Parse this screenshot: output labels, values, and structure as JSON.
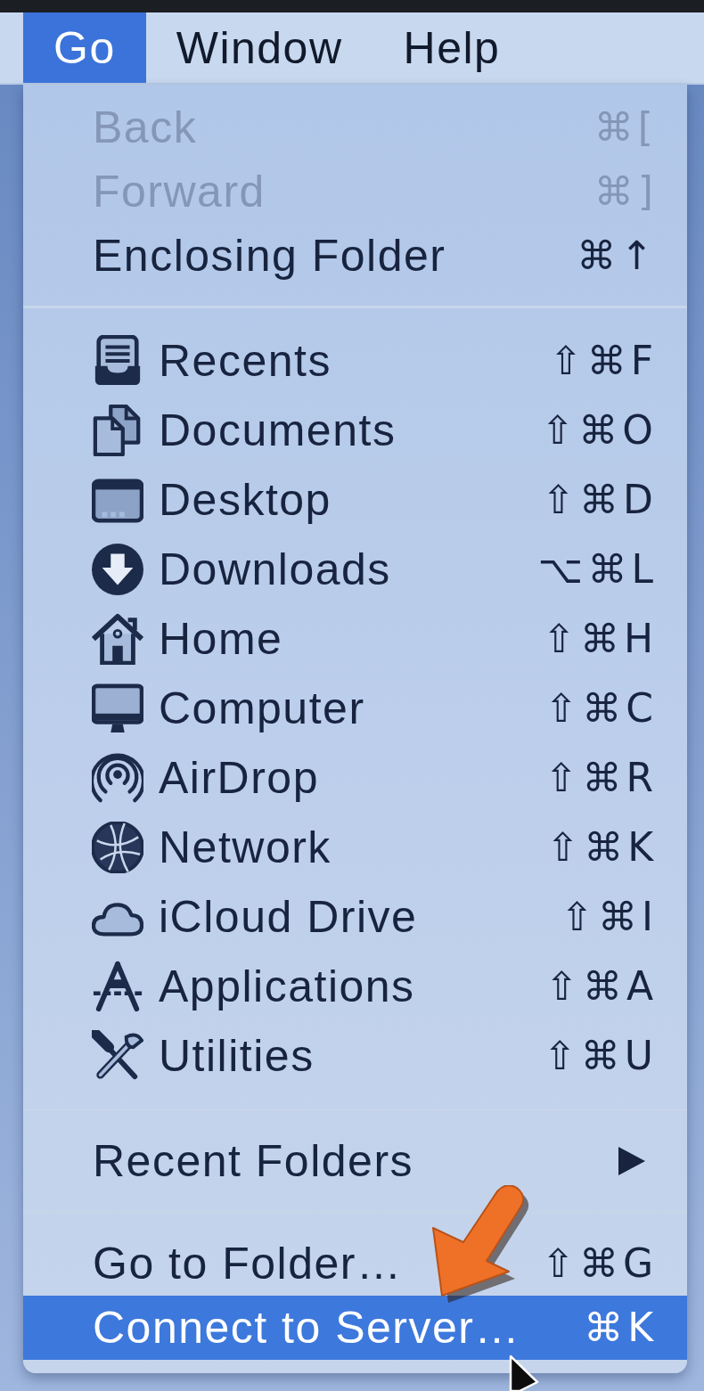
{
  "menu_bar": [
    {
      "label": "Go",
      "selected": true
    },
    {
      "label": "Window",
      "selected": false
    },
    {
      "label": "Help",
      "selected": false
    }
  ],
  "menu": {
    "sections": [
      {
        "items": [
          {
            "kind": "text",
            "label": "Back",
            "shortcut": "⌘[",
            "disabled": true,
            "selected": false
          },
          {
            "kind": "text",
            "label": "Forward",
            "shortcut": "⌘]",
            "disabled": true,
            "selected": false
          },
          {
            "kind": "text",
            "label": "Enclosing Folder",
            "shortcut": "⌘↑",
            "disabled": false,
            "selected": false
          }
        ]
      },
      {
        "items": [
          {
            "kind": "icon",
            "label": "Recents",
            "shortcut": "⇧⌘F",
            "disabled": false,
            "selected": false
          },
          {
            "kind": "icon",
            "label": "Documents",
            "shortcut": "⇧⌘O",
            "disabled": false,
            "selected": false
          },
          {
            "kind": "icon",
            "label": "Desktop",
            "shortcut": "⇧⌘D",
            "disabled": false,
            "selected": false
          },
          {
            "kind": "icon",
            "label": "Downloads",
            "shortcut": "⌥⌘L",
            "disabled": false,
            "selected": false
          },
          {
            "kind": "icon",
            "label": "Home",
            "shortcut": "⇧⌘H",
            "disabled": false,
            "selected": false
          },
          {
            "kind": "icon",
            "label": "Computer",
            "shortcut": "⇧⌘C",
            "disabled": false,
            "selected": false
          },
          {
            "kind": "icon",
            "label": "AirDrop",
            "shortcut": "⇧⌘R",
            "disabled": false,
            "selected": false
          },
          {
            "kind": "icon",
            "label": "Network",
            "shortcut": "⇧⌘K",
            "disabled": false,
            "selected": false
          },
          {
            "kind": "icon",
            "label": "iCloud Drive",
            "shortcut": "⇧⌘I",
            "disabled": false,
            "selected": false
          },
          {
            "kind": "icon",
            "label": "Applications",
            "shortcut": "⇧⌘A",
            "disabled": false,
            "selected": false
          },
          {
            "kind": "icon",
            "label": "Utilities",
            "shortcut": "⇧⌘U",
            "disabled": false,
            "selected": false
          }
        ]
      },
      {
        "items": [
          {
            "kind": "submenu",
            "label": "Recent Folders",
            "disabled": false,
            "selected": false
          }
        ]
      },
      {
        "items": [
          {
            "kind": "text",
            "label": "Go to Folder…",
            "shortcut": "⇧⌘G",
            "disabled": false,
            "selected": false
          },
          {
            "kind": "text",
            "label": "Connect to Server…",
            "shortcut": "⌘K",
            "disabled": false,
            "selected": true
          }
        ]
      }
    ]
  }
}
